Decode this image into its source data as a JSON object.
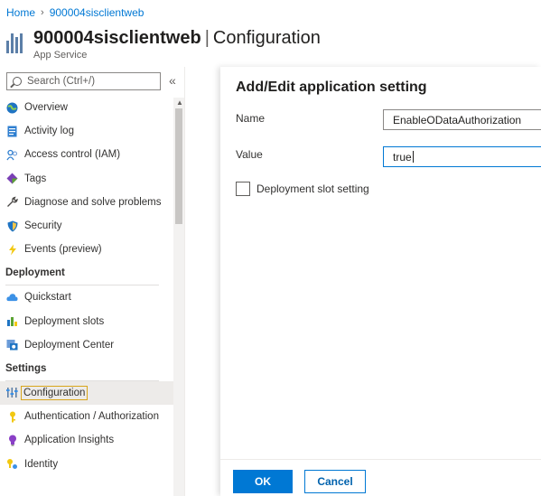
{
  "breadcrumb": {
    "home": "Home",
    "resource": "900004sisclientweb"
  },
  "header": {
    "resource_name": "900004sisclientweb",
    "separator": "|",
    "page_title": "Configuration",
    "subtitle": "App Service"
  },
  "search": {
    "placeholder": "Search (Ctrl+/)"
  },
  "collapse_label": "«",
  "nav": {
    "items_top": [
      {
        "label": "Overview",
        "icon": "globe-icon"
      },
      {
        "label": "Activity log",
        "icon": "activity-log-icon"
      },
      {
        "label": "Access control (IAM)",
        "icon": "people-icon"
      },
      {
        "label": "Tags",
        "icon": "tag-icon"
      },
      {
        "label": "Diagnose and solve problems",
        "icon": "wrench-icon"
      },
      {
        "label": "Security",
        "icon": "shield-icon"
      },
      {
        "label": "Events (preview)",
        "icon": "lightning-icon"
      }
    ],
    "section_deployment": "Deployment",
    "items_deployment": [
      {
        "label": "Quickstart",
        "icon": "cloud-icon"
      },
      {
        "label": "Deployment slots",
        "icon": "slots-icon"
      },
      {
        "label": "Deployment Center",
        "icon": "deployment-center-icon"
      }
    ],
    "section_settings": "Settings",
    "items_settings": [
      {
        "label": "Configuration",
        "icon": "configuration-icon",
        "active": true
      },
      {
        "label": "Authentication / Authorization",
        "icon": "key-icon"
      },
      {
        "label": "Application Insights",
        "icon": "lightbulb-icon"
      },
      {
        "label": "Identity",
        "icon": "identity-icon"
      }
    ]
  },
  "panel": {
    "title": "Add/Edit application setting",
    "name_label": "Name",
    "name_value": "EnableODataAuthorization",
    "value_label": "Value",
    "value_value": "true",
    "deployment_slot_label": "Deployment slot setting",
    "ok_label": "OK",
    "cancel_label": "Cancel"
  },
  "colors": {
    "accent": "#0078d4",
    "focus_outline": "#d8a51b"
  }
}
